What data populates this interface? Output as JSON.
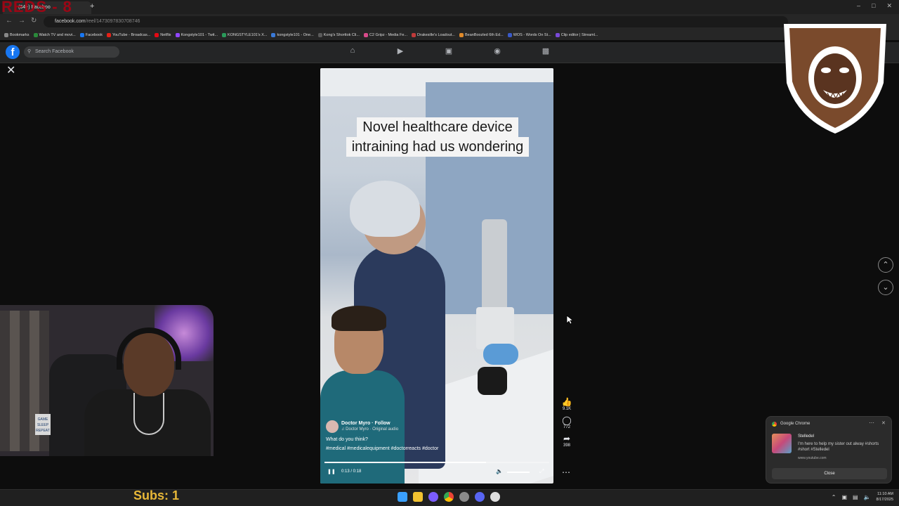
{
  "browser": {
    "tab_title": "(34+) Faceboo",
    "url_host": "facebook.com",
    "url_path": "/reel/1473097830708746",
    "bookmarks": [
      {
        "label": "Bookmarks",
        "color": "#888888"
      },
      {
        "label": "Watch TV and movi...",
        "color": "#2a8a3a"
      },
      {
        "label": "Facebook",
        "color": "#1877f2"
      },
      {
        "label": "YouTube - Broadcas...",
        "color": "#e62117"
      },
      {
        "label": "Netflix",
        "color": "#e50914"
      },
      {
        "label": "Kongstyle101 - Twit...",
        "color": "#9146ff"
      },
      {
        "label": "KONGSTYLE101's X...",
        "color": "#2a9a5a"
      },
      {
        "label": "kongstyle101 - One...",
        "color": "#3a7ad8"
      },
      {
        "label": "Kong's Shorttok Cli...",
        "color": "#5a5a5a"
      },
      {
        "label": "C2 Gripz - Media Fe...",
        "color": "#d84a8a"
      },
      {
        "label": "Drakesille's Loadout...",
        "color": "#c03a3a"
      },
      {
        "label": "BeanBoozled 6th Ed...",
        "color": "#e08a2a"
      },
      {
        "label": "WOS - Words On St...",
        "color": "#3a5ac8"
      },
      {
        "label": "Clip editor | Streaml...",
        "color": "#7a4ad8"
      }
    ]
  },
  "stream_tag": "REDS - 8",
  "facebook": {
    "logo": "f",
    "search_placeholder": "Search Facebook",
    "nav_icons": [
      "home-icon",
      "video-icon",
      "marketplace-icon",
      "groups-icon",
      "gaming-icon"
    ]
  },
  "reel": {
    "caption_line1": "Novel healthcare device",
    "caption_line2": "intraining had us wondering",
    "author": "Doctor Myro · Follow",
    "audio": "♫ Doctor Myro · Original audio",
    "description": "What do you think?",
    "hashtags": "#medical #medicalequipment #doctorreacts #doctor",
    "likes": "9.1K",
    "comments": "772",
    "shares": "398",
    "time": "0:13 / 0:18",
    "progress": 0.72
  },
  "notification": {
    "app": "Google Chrome",
    "title": "Stelledel",
    "body": "I'm here to help my sister out alway #shorts #short #Stelledel",
    "site": "www.youtube.com",
    "close_label": "Close"
  },
  "overlay": {
    "subs": "Subs: 1",
    "cam_sign": "GAME SLEEP REPEAT"
  },
  "taskbar": {
    "time": "11:10 AM",
    "date": "8/17/2025"
  }
}
